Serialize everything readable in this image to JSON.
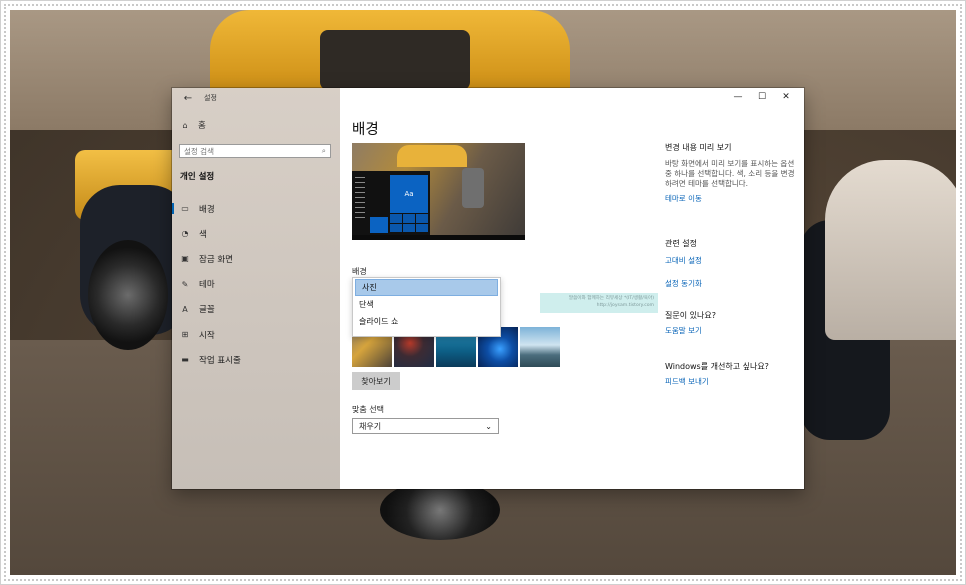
{
  "window": {
    "app_title": "설정",
    "controls": {
      "minimize": "—",
      "maximize": "☐",
      "close": "✕"
    }
  },
  "sidebar": {
    "home_label": "홈",
    "search_placeholder": "설정 검색",
    "section_heading": "개인 설정",
    "items": [
      {
        "label": "배경",
        "icon": "image-icon",
        "active": true
      },
      {
        "label": "색",
        "icon": "palette-icon",
        "active": false
      },
      {
        "label": "잠금 화면",
        "icon": "lock-screen-icon",
        "active": false
      },
      {
        "label": "테마",
        "icon": "theme-icon",
        "active": false
      },
      {
        "label": "글꼴",
        "icon": "font-icon",
        "active": false
      },
      {
        "label": "시작",
        "icon": "start-icon",
        "active": false
      },
      {
        "label": "작업 표시줄",
        "icon": "taskbar-icon",
        "active": false
      }
    ]
  },
  "main": {
    "title": "배경",
    "preview": {
      "tile_text": "Aa"
    },
    "background_label": "배경",
    "background_options": [
      "사진",
      "단색",
      "슬라이드 쇼"
    ],
    "background_selected": "사진",
    "watermark_text": "말씀이와 함께하는 리뷰세상 *(IT/생활/육아)",
    "watermark_url": "http://joysam.tistory.com",
    "browse_button": "찾아보기",
    "fit_label": "맞춤 선택",
    "fit_value": "채우기"
  },
  "side": {
    "preview_heading": "변경 내용 미리 보기",
    "preview_text": "바탕 화면에서 미리 보기를 표시하는 옵션 중 하나를 선택합니다. 색, 소리 등을 변경하려면 테마를 선택합니다.",
    "themes_link": "테마로 이동",
    "related_heading": "관련 설정",
    "high_contrast_link": "고대비 설정",
    "sync_link": "설정 동기화",
    "question_heading": "질문이 있나요?",
    "help_link": "도움말 보기",
    "improve_heading": "Windows를 개선하고 싶나요?",
    "feedback_link": "피드백 보내기"
  },
  "colors": {
    "accent": "#0063b1",
    "link": "#0b66b8",
    "selected_option": "#a8c9ea"
  }
}
